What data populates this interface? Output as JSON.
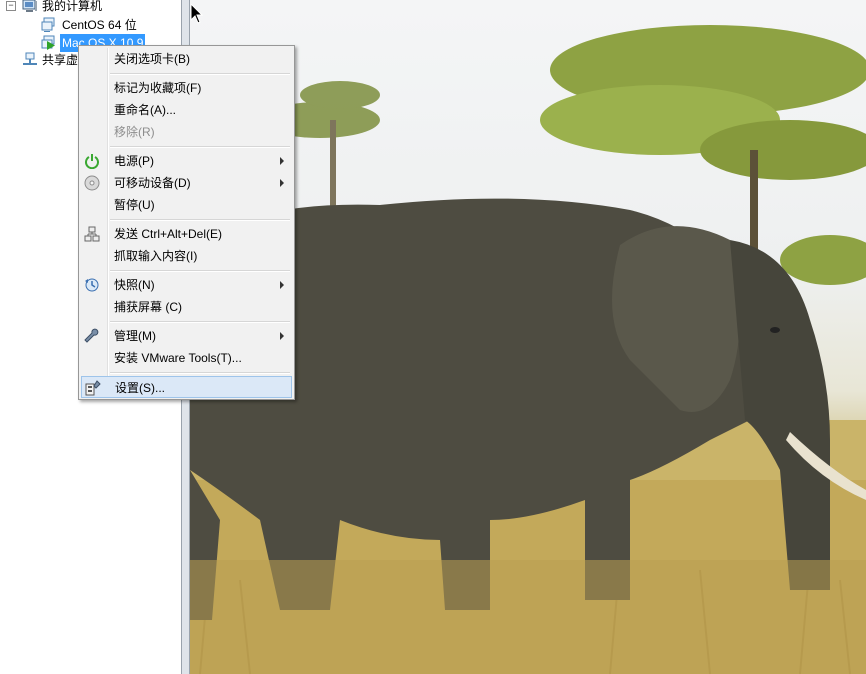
{
  "tree": {
    "root_label": "我的计算机",
    "expander": "⊟",
    "vms": [
      {
        "label": "CentOS 64 位",
        "icon": "vm-icon"
      },
      {
        "label": "Mac OS X 10.9",
        "icon": "vm-running-icon",
        "selected": true
      }
    ],
    "shared_label": "共享虚"
  },
  "context_menu": {
    "items": [
      {
        "label": "关闭选项卡(B)"
      },
      {
        "label": "标记为收藏项(F)"
      },
      {
        "label": "重命名(A)..."
      },
      {
        "label": "移除(R)",
        "disabled": true
      },
      {
        "label": "电源(P)",
        "icon": "power-icon",
        "submenu": true
      },
      {
        "label": "可移动设备(D)",
        "icon": "removable-device-icon",
        "submenu": true
      },
      {
        "label": "暂停(U)"
      },
      {
        "label": "发送 Ctrl+Alt+Del(E)",
        "icon": "network-keys-icon"
      },
      {
        "label": "抓取输入内容(I)"
      },
      {
        "label": "快照(N)",
        "icon": "snapshot-icon",
        "submenu": true
      },
      {
        "label": "捕获屏幕 (C)"
      },
      {
        "label": "管理(M)",
        "icon": "wrench-icon",
        "submenu": true
      },
      {
        "label": "安装 VMware Tools(T)..."
      },
      {
        "label": "设置(S)...",
        "icon": "settings-icon",
        "highlighted": true
      }
    ]
  },
  "colors": {
    "selection": "#3399ff",
    "menu_highlight": "#dbe8f7",
    "power_green": "#3aa832"
  }
}
